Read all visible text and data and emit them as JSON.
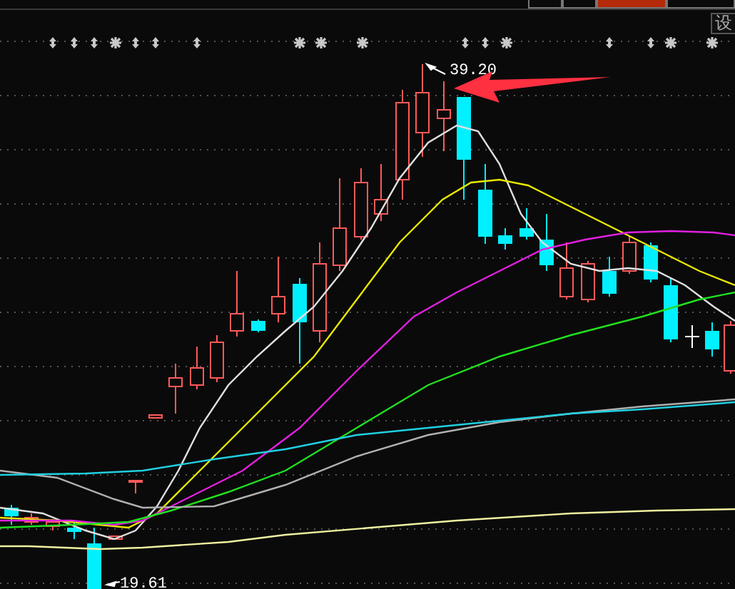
{
  "tabs": [
    {
      "selected": false
    },
    {
      "selected": false
    },
    {
      "selected": true
    },
    {
      "selected": false
    }
  ],
  "settings_button": {
    "label": "设"
  },
  "signal_markers": [
    {
      "kind": "updown"
    },
    {
      "kind": "updown"
    },
    {
      "kind": "updown"
    },
    {
      "kind": "star"
    },
    {
      "kind": "updown"
    },
    {
      "kind": "updown"
    },
    {
      "kind": "updown"
    },
    {
      "kind": "star"
    },
    {
      "kind": "star"
    },
    {
      "kind": "star"
    },
    {
      "kind": "updown"
    },
    {
      "kind": "updown"
    },
    {
      "kind": "star"
    },
    {
      "kind": "updown"
    },
    {
      "kind": "updown"
    },
    {
      "kind": "star"
    },
    {
      "kind": "star"
    }
  ],
  "chart": {
    "high_label": "39.20",
    "low_label": "19.61"
  }
}
